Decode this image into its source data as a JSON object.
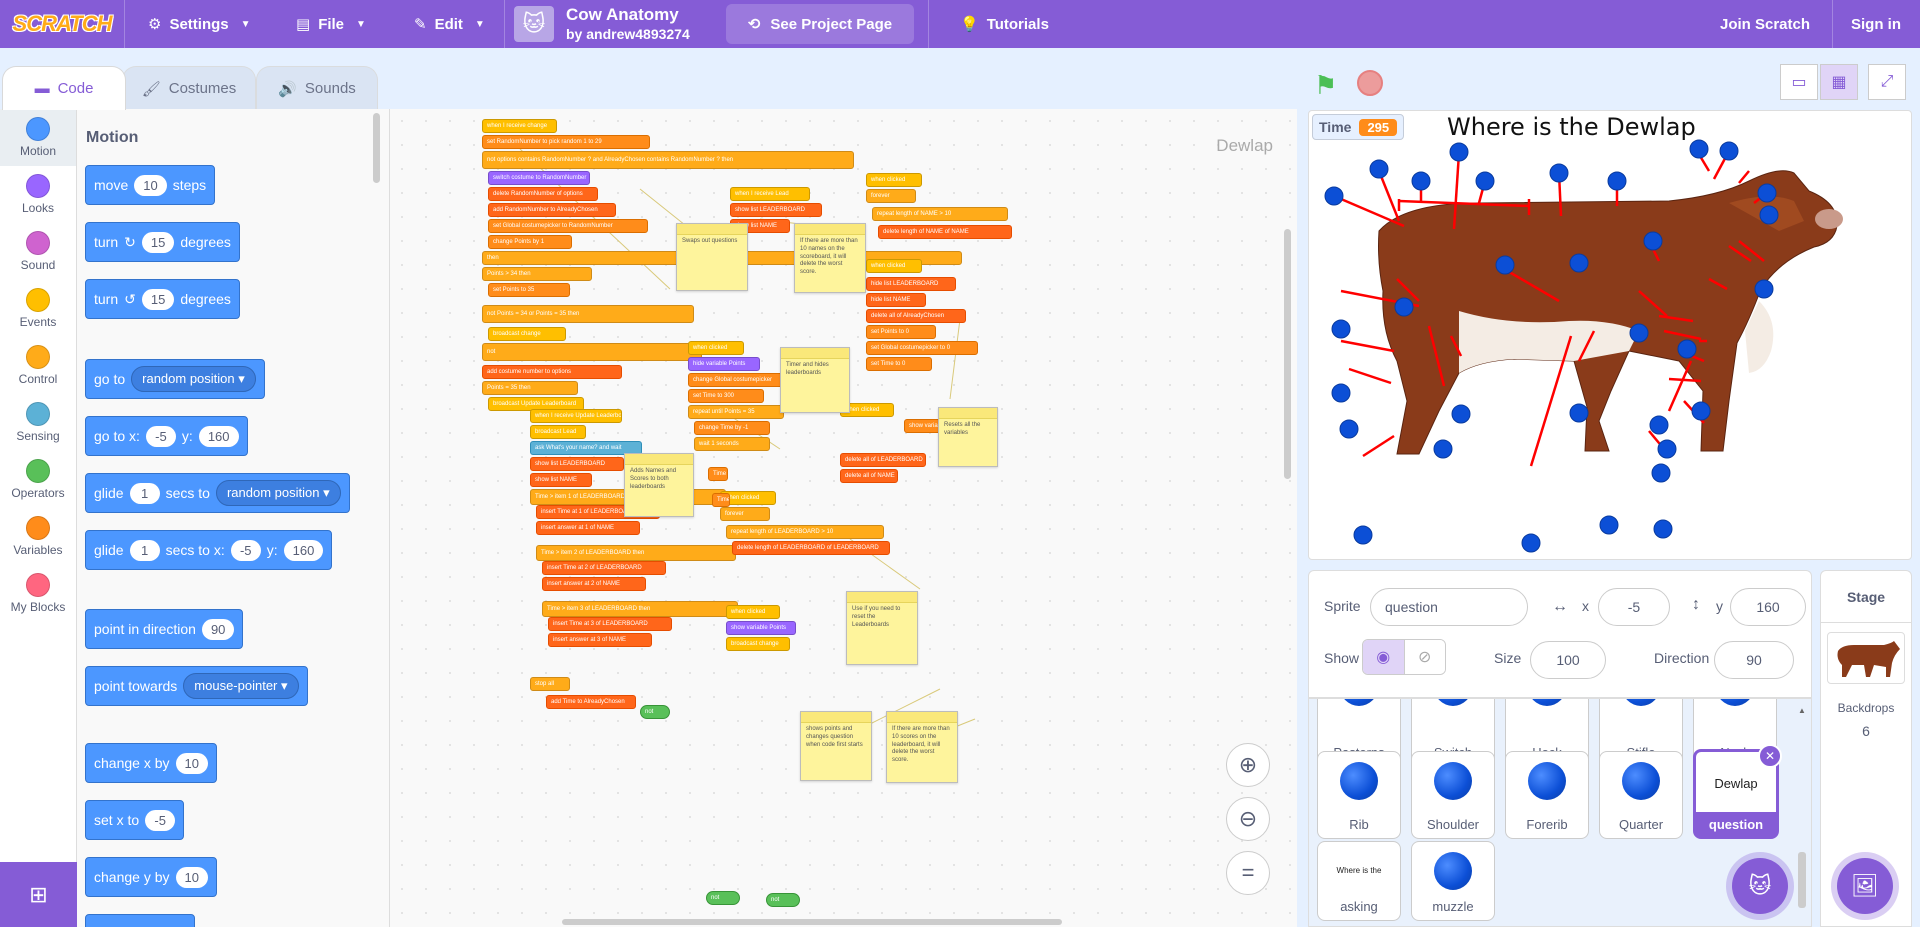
{
  "menubar": {
    "logo": "SCRATCH",
    "settings": "Settings",
    "file": "File",
    "edit": "Edit",
    "project_title": "Cow Anatomy",
    "project_author": "by andrew4893274",
    "see_project": "See Project Page",
    "tutorials": "Tutorials",
    "join": "Join Scratch",
    "signin": "Sign in"
  },
  "tabs": {
    "code": "Code",
    "costumes": "Costumes",
    "sounds": "Sounds"
  },
  "categories": [
    {
      "label": "Motion",
      "color": "#4c97ff"
    },
    {
      "label": "Looks",
      "color": "#9966ff"
    },
    {
      "label": "Sound",
      "color": "#cf63cf"
    },
    {
      "label": "Events",
      "color": "#ffbf00"
    },
    {
      "label": "Control",
      "color": "#ffab19"
    },
    {
      "label": "Sensing",
      "color": "#5cb1d6"
    },
    {
      "label": "Operators",
      "color": "#59c059"
    },
    {
      "label": "Variables",
      "color": "#ff8c1a"
    },
    {
      "label": "My Blocks",
      "color": "#ff6680"
    }
  ],
  "palette": {
    "title": "Motion",
    "move": {
      "a": "move",
      "n": "10",
      "b": "steps"
    },
    "turn_right": {
      "a": "turn",
      "n": "15",
      "b": "degrees"
    },
    "turn_left": {
      "a": "turn",
      "n": "15",
      "b": "degrees"
    },
    "goto": {
      "a": "go to",
      "d": "random position"
    },
    "gotoxy": {
      "a": "go to x:",
      "x": "-5",
      "b": "y:",
      "y": "160"
    },
    "glide": {
      "a": "glide",
      "n": "1",
      "b": "secs to",
      "d": "random position"
    },
    "glidexy": {
      "a": "glide",
      "n": "1",
      "b": "secs to x:",
      "x": "-5",
      "c": "y:",
      "y": "160"
    },
    "point_dir": {
      "a": "point in direction",
      "n": "90"
    },
    "point_towards": {
      "a": "point towards",
      "d": "mouse-pointer"
    },
    "change_x": {
      "a": "change x by",
      "n": "10"
    },
    "set_x": {
      "a": "set x to",
      "n": "-5"
    },
    "change_y": {
      "a": "change y by",
      "n": "10"
    }
  },
  "workspace": {
    "sprite_label": "Dewlap",
    "blocks": {
      "b01": "when I receive  change",
      "b02": "set  RandomNumber  to  pick random 1 to 29",
      "b03": "not  options  contains  RandomNumber ?  and  AlreadyChosen  contains  RandomNumber ?  then",
      "b04": "switch costume to  RandomNumber",
      "b05": "delete  RandomNumber  of  options",
      "b06": "add  RandomNumber  to  AlreadyChosen",
      "b07": "set  Global costumepicker  to  RandomNumber",
      "b08": "change  Points  by  1",
      "b09": "Points  > 34  then",
      "b10": "set  Points  to  35",
      "b11": "not  Points  = 34  or  Points  = 35  then",
      "b12": "broadcast  change",
      "b13": "add  costume  number  to  options",
      "b14": "Points  = 35  then",
      "b15": "broadcast  Update Leaderboard",
      "b16": "when I receive  Lead",
      "b17": "show list  LEADERBOARD",
      "b18": "show list  NAME",
      "b19": "when clicked",
      "b20": "forever",
      "b21": "repeat  length of  NAME  > 10",
      "b22": "delete  length of  NAME  of  NAME",
      "b23": "when clicked",
      "b24": "hide list  LEADERBOARD",
      "b25": "hide list  NAME",
      "b26": "delete all of  AlreadyChosen",
      "b27": "set  Points  to  0",
      "b28": "set  Global costumepicker  to  0",
      "b29": "set  Time  to  0",
      "b30": "when clicked",
      "b31": "hide variable  Points",
      "b32": "change  Global costumepicker",
      "b33": "set  Time  to  300",
      "b34": "repeat until  Points  = 35",
      "b35": "change  Time  by  -1",
      "b36": "wait  1  seconds",
      "b37": "when clicked",
      "b38": "show variable  Points",
      "b39": "when I receive  Update Leaderboard",
      "b40": "broadcast  Lead",
      "b41": "ask  What's your name?  and wait",
      "b42": "show list  LEADERBOARD",
      "b43": "show list  NAME",
      "b44": "Time  > item 1 of  LEADERBOARD  then",
      "b45": "insert  Time  at  1  of  LEADERBOARD",
      "b46": "insert  answer  at  1  of  NAME",
      "b47": "Time  > item 2 of  LEADERBOARD  then",
      "b48": "insert  Time  at  2  of  LEADERBOARD",
      "b49": "insert  answer  at  2  of  NAME",
      "b50": "Time  > item 3 of  LEADERBOARD  then",
      "b51": "insert  Time  at  3  of  LEADERBOARD",
      "b52": "insert  answer  at  3  of  NAME",
      "b53": "stop  all",
      "b54": "add  Time  to  AlreadyChosen",
      "b55": "delete all of  LEADERBOARD",
      "b56": "delete all of  NAME",
      "b57": "when clicked",
      "b58": "forever",
      "b59": "repeat  length of  LEADERBOARD  > 10",
      "b60": "delete  length of  LEADERBOARD  of  LEADERBOARD",
      "b61": "when clicked",
      "b62": "show variable  Points",
      "b63": "broadcast  change",
      "b64": "show variable  Points",
      "b65": "Time",
      "b66": "Time",
      "b67": "not",
      "b68": "not",
      "b69": "not",
      "b70": "then"
    },
    "comments": {
      "c1": "Swaps out questions",
      "c2": "If there are more than 10 names on the scoreboard, it will delete the worst score.",
      "c3": "Timer and hides leaderboards",
      "c4": "Resets all the variables",
      "c5": "Adds Names and Scores to both leaderboards",
      "c6": "Use if you need to reset the Leaderboards",
      "c7": "shows points and changes question when code first starts",
      "c8": "If there are more than 10 scores on the leaderboard, it will delete the worst score."
    }
  },
  "stage": {
    "time_label": "Time",
    "time_value": "295",
    "title": "Where is the Dewlap"
  },
  "sprite_info": {
    "sprite_label": "Sprite",
    "sprite_name": "question",
    "x_label": "x",
    "x_value": "-5",
    "y_label": "y",
    "y_value": "160",
    "show_label": "Show",
    "size_label": "Size",
    "size_value": "100",
    "direction_label": "Direction",
    "direction_value": "90"
  },
  "sprites": {
    "row1": [
      "Pasterns",
      "Switch",
      "Hock",
      "Stifle",
      "Neck"
    ],
    "row2": [
      "Rib",
      "Shoulder",
      "Forerib",
      "Quarter"
    ],
    "selected": "question",
    "selected_thumb": "Dewlap",
    "asking": "asking",
    "asking_thumb": "Where is the",
    "muzzle": "muzzle"
  },
  "stage_pane": {
    "title": "Stage",
    "backdrops_label": "Backdrops",
    "backdrops_count": "6"
  },
  "colors": {
    "accent": "#855cd6",
    "motion": "#4c97ff",
    "workspace_bg": "#f9f9f9",
    "page_bg": "#e5f0ff"
  }
}
